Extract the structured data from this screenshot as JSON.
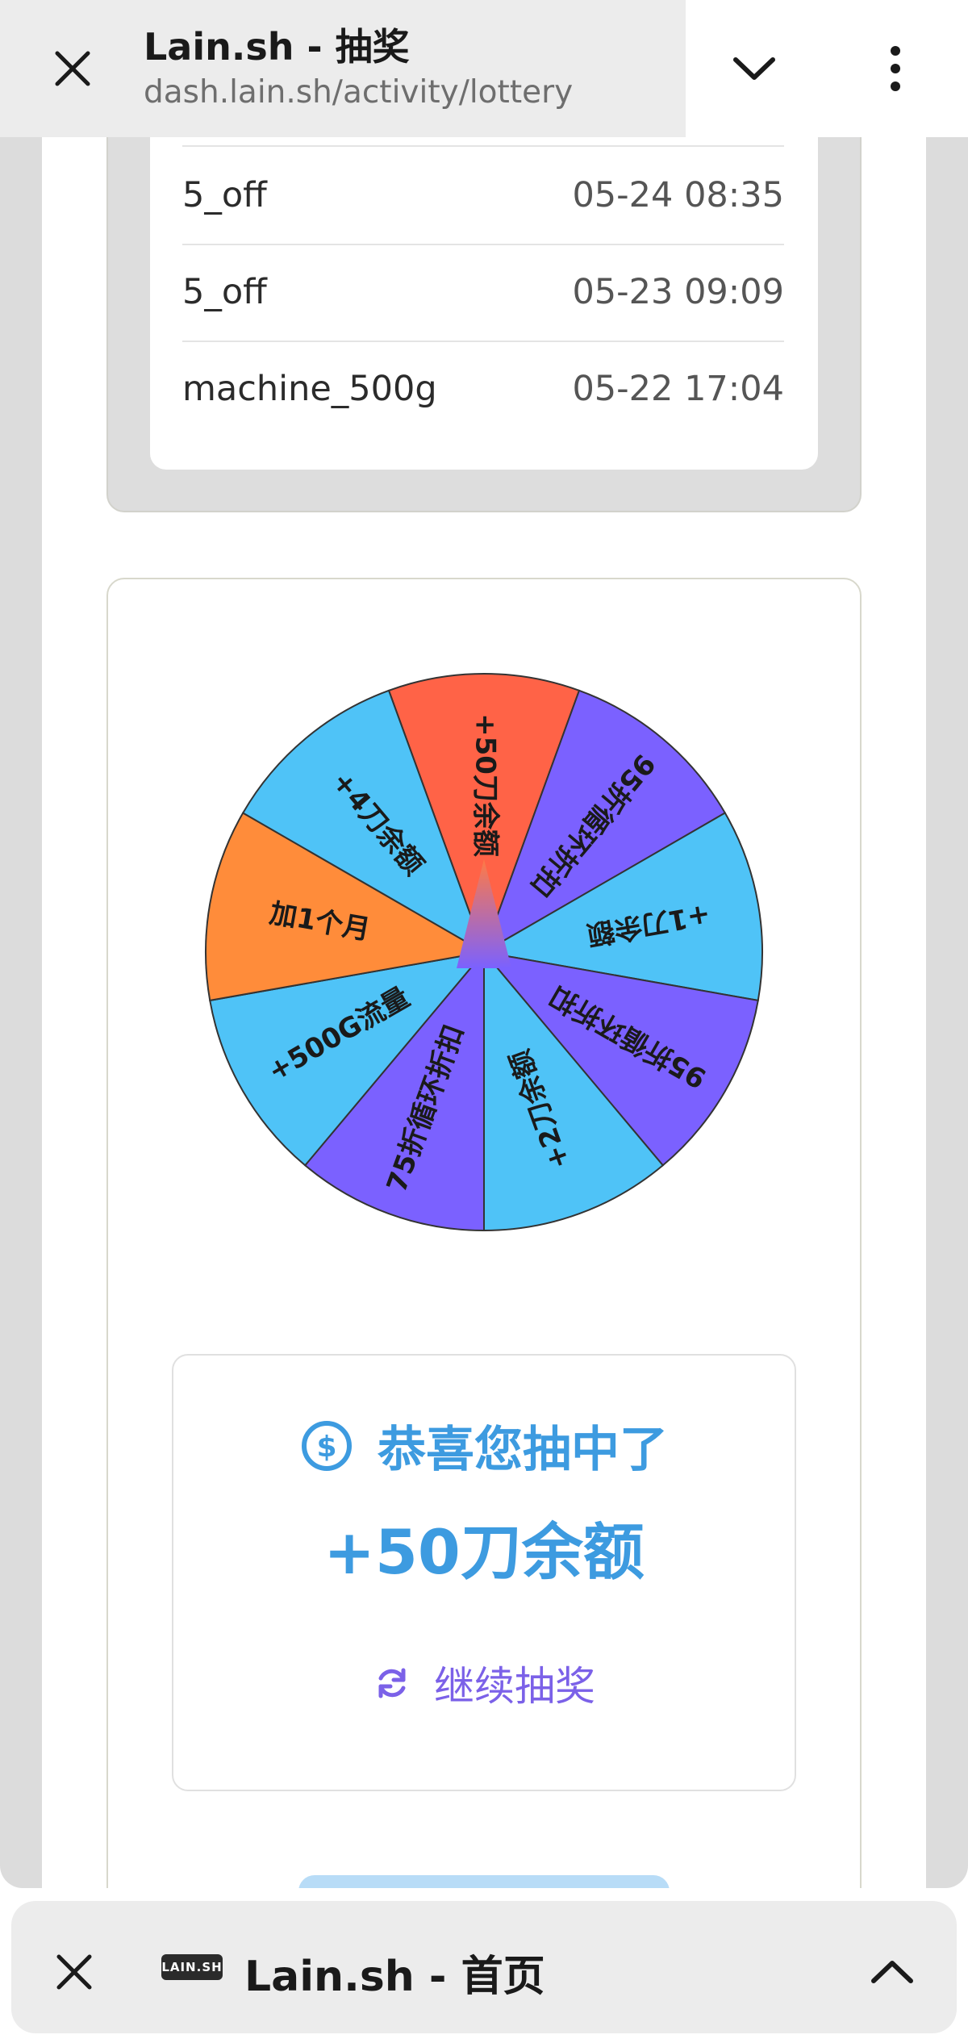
{
  "topbar": {
    "title": "Lain.sh - 抽奖",
    "url": "dash.lain.sh/activity/lottery"
  },
  "history": [
    {
      "prize": "5_off",
      "time": "05-24 08:35"
    },
    {
      "prize": "5_off",
      "time": "05-23 09:09"
    },
    {
      "prize": "machine_500g",
      "time": "05-22 17:04"
    }
  ],
  "wheel": {
    "segments": [
      {
        "label": "+50刀余额",
        "color": "#ff6347"
      },
      {
        "label": "95折循环折扣",
        "color": "#7b61ff"
      },
      {
        "label": "+1刀余额",
        "color": "#4fc3f7"
      },
      {
        "label": "95折循环折扣",
        "color": "#7b61ff"
      },
      {
        "label": "+2刀余额",
        "color": "#4fc3f7"
      },
      {
        "label": "75折循环折扣",
        "color": "#7b61ff"
      },
      {
        "label": "+500G流量",
        "color": "#4fc3f7"
      },
      {
        "label": "加1个月",
        "color": "#ff8c3a"
      },
      {
        "label": "+4刀余额",
        "color": "#4fc3f7"
      }
    ]
  },
  "result": {
    "congrats": "恭喜您抽中了",
    "prize": "+50刀余额",
    "again_label": "继续抽奖"
  },
  "bottombar": {
    "logo_text": "LAIN.SH",
    "title": "Lain.sh - 首页"
  },
  "colors": {
    "accent_blue": "#3d9be0",
    "accent_purple": "#7b61e8"
  }
}
